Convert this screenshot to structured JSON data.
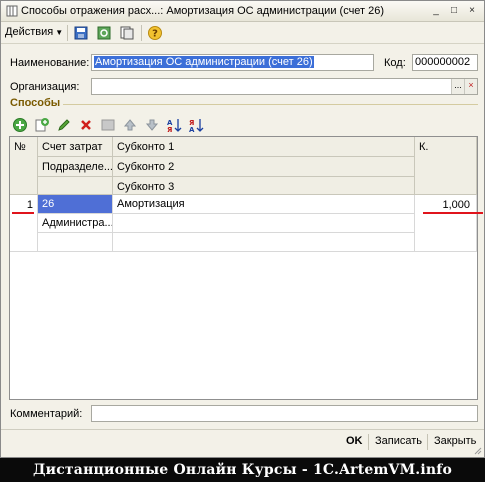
{
  "window": {
    "title": "Способы отражения расх...: Амортизация ОС администрации (счет 26)",
    "buttons": [
      "_",
      "□",
      "×"
    ]
  },
  "toolbar": {
    "actions_label": "Действия",
    "icons": [
      "save-icon",
      "refresh-icon",
      "copy-icon",
      "help-icon"
    ]
  },
  "form": {
    "name_label": "Наименование:",
    "name_value": "Амортизация ОС администрации (счет 26)",
    "code_label": "Код:",
    "code_value": "000000002",
    "org_label": "Организация:",
    "org_value": "",
    "org_button": "...",
    "org_clear": "×"
  },
  "section": {
    "title": "Способы"
  },
  "table_toolbar": {
    "icons": [
      "add-icon",
      "add-copy-icon",
      "edit-icon",
      "delete-icon",
      "post-icon",
      "move-up-icon",
      "move-down-icon",
      "sort-asc-icon",
      "sort-desc-icon"
    ]
  },
  "table": {
    "headers": {
      "num": "№",
      "account": "Счет затрат",
      "department": "Подразделе...",
      "subconto1": "Субконто 1",
      "subconto2": "Субконто 2",
      "subconto3": "Субконто 3",
      "k": "К."
    },
    "rows": [
      {
        "num": "1",
        "account": "26",
        "department": "Администра...",
        "subconto1": "Амортизация",
        "subconto2": "",
        "subconto3": "",
        "k": "1,000"
      }
    ]
  },
  "comment": {
    "label": "Комментарий:",
    "value": ""
  },
  "footer": {
    "ok": "OK",
    "save": "Записать",
    "close": "Закрыть"
  },
  "banner": {
    "text": "Дистанционные Онлайн Курсы - 1C.ArtemVM.info"
  },
  "colors": {
    "accent": "#e0141c",
    "selection": "#3c6fd8",
    "section_title": "#7a5a00"
  }
}
